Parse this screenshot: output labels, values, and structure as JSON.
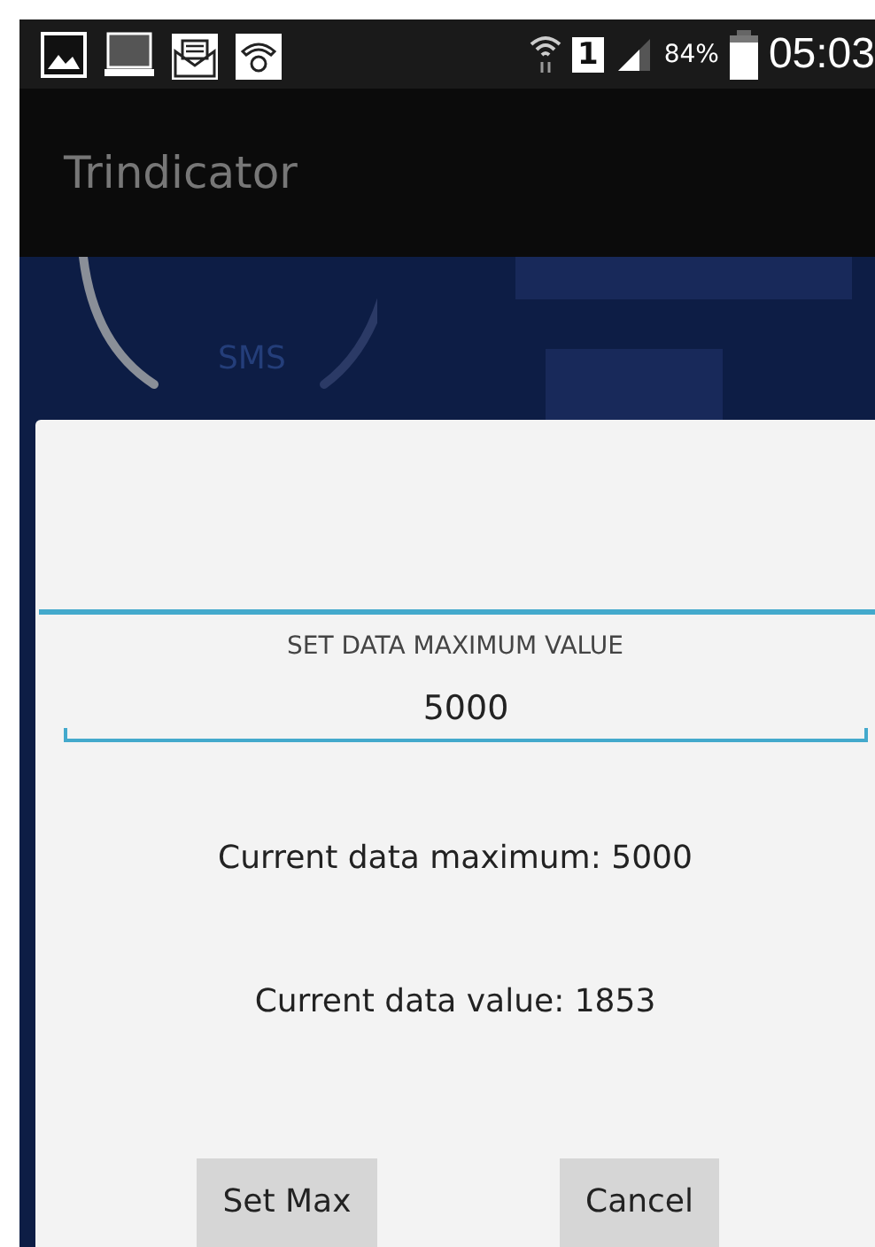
{
  "status_bar": {
    "battery": "84%",
    "sim": "1",
    "time": "05:03"
  },
  "app_bar": {
    "title": "Trindicator"
  },
  "background": {
    "gauge_label": "SMS"
  },
  "dialog": {
    "title": "SET DATA MAXIMUM VALUE",
    "input": {
      "value": "5000"
    },
    "current_maximum": "Current data maximum: 5000",
    "current_value": "Current data value: 1853",
    "buttons": [
      "Set Max",
      "Cancel"
    ]
  }
}
